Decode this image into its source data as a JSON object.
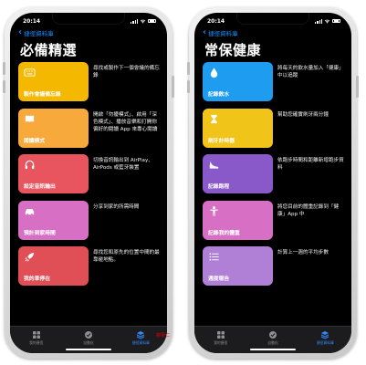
{
  "status": {
    "time": "20:14"
  },
  "colors": {
    "accent": "#1a8cff",
    "watermark": "#d40000"
  },
  "left": {
    "back_label": "捷徑資料庫",
    "title": "必備精選",
    "rows": [
      {
        "label": "製作會議備忘錄",
        "desc": "尋找或製作下一個會議的備忘錄",
        "color": "#f5b800",
        "icon": "keyboard-icon"
      },
      {
        "label": "閱讀模式",
        "desc": "開啟「勿擾模式」、啟用「深色模式」、播放音樂和打開你偏好的閱讀 App 來專心閱讀",
        "color": "#f7a93b",
        "icon": "book-icon"
      },
      {
        "label": "設定音訊輸出",
        "desc": "切換音訊輸出到 AirPlay、AirPods 或藍牙裝置",
        "color": "#e8555e",
        "icon": "headphones-icon"
      },
      {
        "label": "預計到家時間",
        "desc": "分享到家的所需時間",
        "color": "#d770c4",
        "icon": "car-icon"
      },
      {
        "label": "我的車停在",
        "desc": "尋找您和原先的位置中間的最靠碰地點。",
        "color": "#e14f56",
        "icon": "rocket-icon"
      }
    ]
  },
  "right": {
    "back_label": "捷徑資料庫",
    "title": "常保健康",
    "rows": [
      {
        "label": "記錄飲水",
        "desc": "將每天的飲水量加入「健康」中以追蹤",
        "color": "#1e9cf0",
        "icon": "water-drop-icon"
      },
      {
        "label": "刷牙計時器",
        "desc": "幫助您確實刷牙兩分鐘",
        "color": "#f0c419",
        "icon": "hourglass-icon"
      },
      {
        "label": "記錄跑程",
        "desc": "依跑步時間和距離新增跑步資料",
        "color": "#8a59c9",
        "icon": "sneaker-icon"
      },
      {
        "label": "記錄我的體重",
        "desc": "將您目前的體重記錄到「健康」App 中",
        "color": "#d770c4",
        "icon": "person-icon"
      },
      {
        "label": "週度報告",
        "desc": "計算上一週的平均步數",
        "color": "#b07fd6",
        "icon": "list-icon"
      }
    ]
  },
  "tabbar": {
    "items": [
      {
        "label": "我的捷徑",
        "icon": "grid-icon",
        "active": false
      },
      {
        "label": "自動化",
        "icon": "clock-check-icon",
        "active": false
      },
      {
        "label": "捷徑資料庫",
        "icon": "layers-icon",
        "active": true
      }
    ]
  },
  "watermark": "蘋果仁"
}
